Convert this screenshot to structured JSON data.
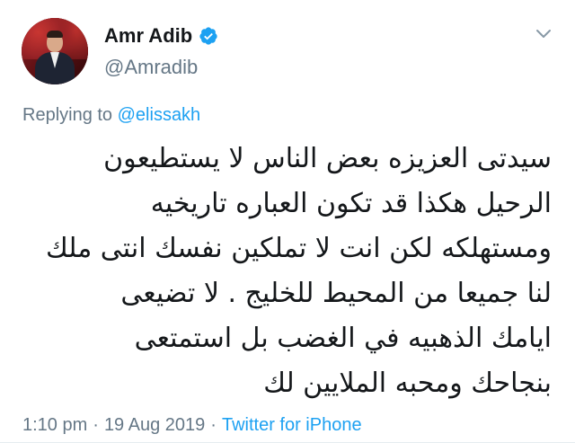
{
  "user": {
    "display_name": "Amr Adib",
    "handle": "@Amradib",
    "verified": true
  },
  "reply": {
    "prefix": "Replying to",
    "mention": "@elissakh"
  },
  "tweet": {
    "lines": [
      "سيدتى العزيزه بعض الناس لا يستطيعون",
      "الرحيل هكذا قد تكون العباره تاريخيه",
      "ومستهلكه لكن انت لا تملكين نفسك انتى ملك",
      "لنا جميعا من المحيط للخليج . لا تضيعى",
      "ايامك الذهبيه في الغضب بل استمتعى",
      "بنجاحك ومحبه الملايين لك"
    ]
  },
  "meta": {
    "time": "1:10 pm",
    "separator": "·",
    "date": "19 Aug 2019",
    "source": "Twitter for iPhone"
  },
  "icons": {
    "verified": "verified-badge-icon",
    "menu": "chevron-down-icon"
  },
  "colors": {
    "link": "#1da1f2",
    "muted": "#657786",
    "text": "#14171a"
  }
}
